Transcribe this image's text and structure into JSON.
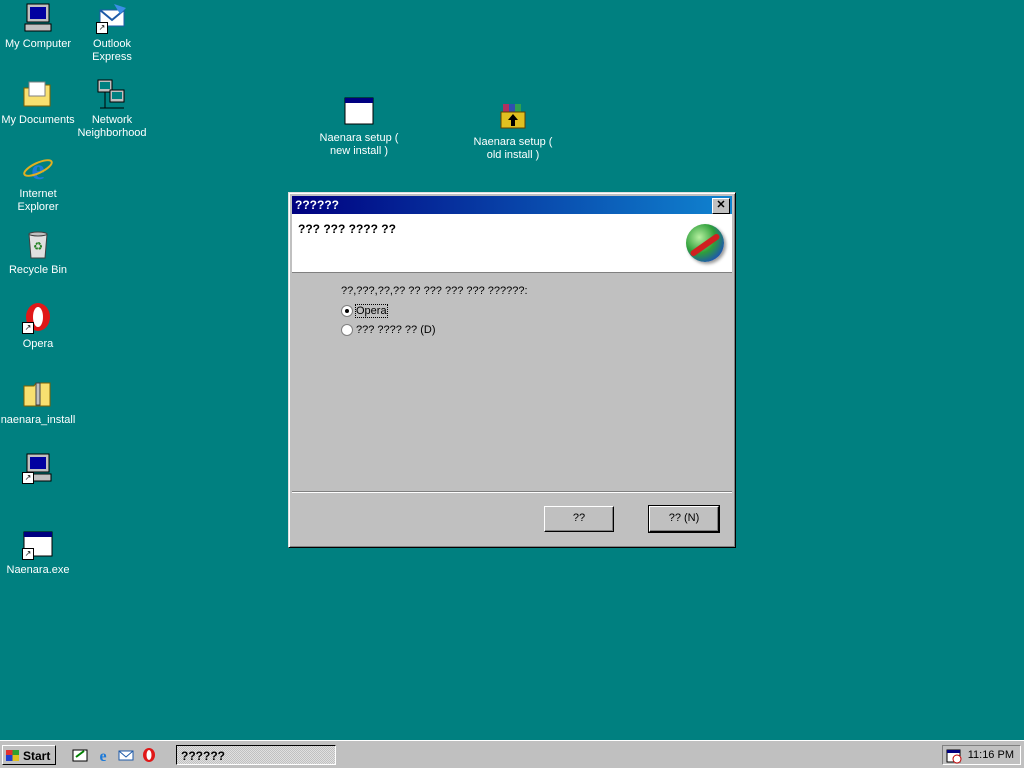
{
  "desktop": {
    "icons": [
      {
        "label": "My Computer",
        "icon": "my-computer-icon"
      },
      {
        "label": "Outlook Express",
        "icon": "outlook-express-icon"
      },
      {
        "label": "My Documents",
        "icon": "my-documents-icon"
      },
      {
        "label": "Network Neighborhood",
        "icon": "network-neighborhood-icon"
      },
      {
        "label": "Internet Explorer",
        "icon": "internet-explorer-icon"
      },
      {
        "label": "Recycle Bin",
        "icon": "recycle-bin-icon"
      },
      {
        "label": "Opera",
        "icon": "opera-icon"
      },
      {
        "label": "naenara_install",
        "icon": "zip-folder-icon"
      },
      {
        "label": "",
        "icon": "computer-shortcut-icon"
      },
      {
        "label": "Naenara.exe",
        "icon": "exe-window-icon"
      },
      {
        "label": "Naenara setup ( new install )",
        "icon": "setup-window-icon"
      },
      {
        "label": "Naenara setup ( old install )",
        "icon": "winrar-archive-icon"
      }
    ]
  },
  "dialog": {
    "title": "??????",
    "close_glyph": "✕",
    "header_title": "??? ??? ???? ??",
    "question": "??,???,??,?? ?? ??? ??? ??? ??????:",
    "options": [
      {
        "label": "Opera",
        "checked": true
      },
      {
        "label": "??? ???? ?? (D)",
        "checked": false
      }
    ],
    "buttons": {
      "back": "??",
      "next": "?? (N)"
    }
  },
  "taskbar": {
    "start_label": "Start",
    "quicklaunch": [
      "show-desktop-icon",
      "internet-explorer-icon",
      "outlook-express-icon",
      "opera-icon"
    ],
    "task_button": "??????",
    "clock": "11:16 PM"
  }
}
